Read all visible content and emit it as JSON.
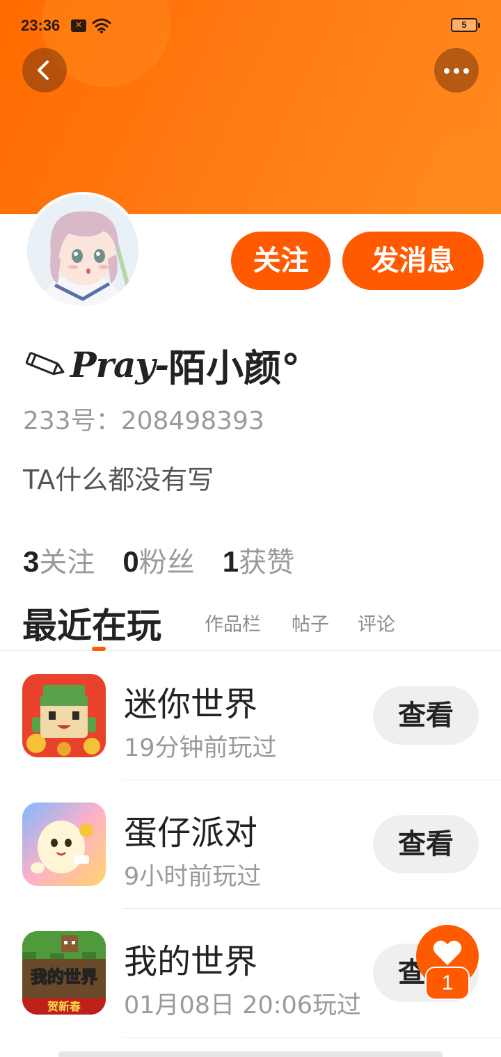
{
  "status_bar": {
    "time": "23:36",
    "notification_icon": "close-box-icon",
    "wifi_icon": "wifi-icon",
    "battery_level": "5"
  },
  "header": {
    "back_icon": "chevron-left-icon",
    "more_icon": "more-dots-icon",
    "accent_color": "#ff6a00"
  },
  "profile": {
    "username_prefix": "Pray-",
    "username_main": "陌小颜°",
    "id_text": "233号：208498393",
    "bio": "TA什么都没有写",
    "follow_label": "关注",
    "message_label": "发消息",
    "stats": [
      {
        "count": "3",
        "label": "关注"
      },
      {
        "count": "0",
        "label": "粉丝"
      },
      {
        "count": "1",
        "label": "获赞"
      }
    ]
  },
  "tabs": {
    "active": "最近在玩",
    "others": [
      "作品栏",
      "帖子",
      "评论"
    ]
  },
  "games": [
    {
      "name": "迷你世界",
      "played": "19分钟前玩过",
      "action": "查看"
    },
    {
      "name": "蛋仔派对",
      "played": "9小时前玩过",
      "action": "查看"
    },
    {
      "name": "我的世界",
      "played": "01月08日 20:06玩过",
      "action": "查看",
      "icon_banner": "贺新春",
      "icon_title": "我的世界"
    }
  ],
  "fab": {
    "icon": "heart-icon",
    "badge": "1"
  }
}
